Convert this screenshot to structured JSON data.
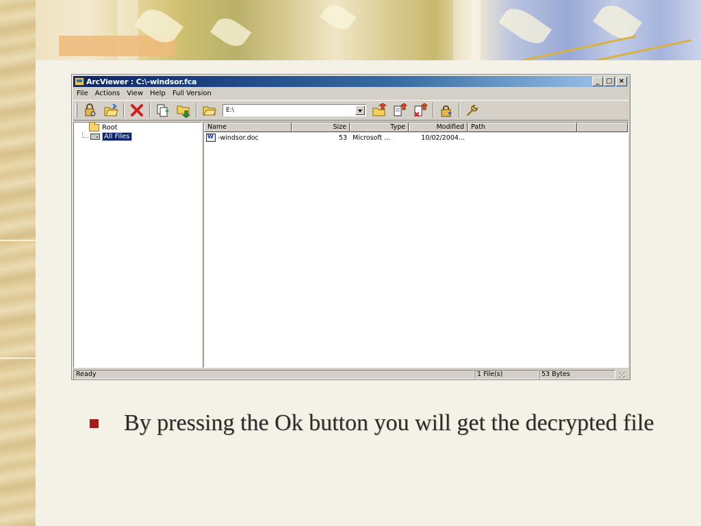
{
  "window": {
    "title": "ArcViewer : C:\\-windsor.fca",
    "minimize_label": "_",
    "maximize_label": "□",
    "close_label": "×"
  },
  "menu": [
    "File",
    "Actions",
    "View",
    "Help",
    "Full Version"
  ],
  "toolbar": {
    "path_value": "E:\\",
    "icons": [
      "decrypt-key-icon",
      "open-folder-icon",
      "delete-icon",
      "extract-icon",
      "extract-folder-icon",
      "folder-icon",
      "add-file-icon",
      "add-document-icon",
      "remove-file-icon",
      "lock-icon",
      "settings-wrench-icon"
    ]
  },
  "tree": {
    "root_label": "Root",
    "all_files_label": "All Files"
  },
  "list": {
    "columns": [
      "Name",
      "Size",
      "Type",
      "Modified",
      "Path"
    ],
    "rows": [
      {
        "name": "-windsor.doc",
        "size": "53",
        "type": "Microsoft ...",
        "modified": "10/02/2004...",
        "path": ""
      }
    ]
  },
  "status": {
    "text": "Ready",
    "file_count": "1 File(s)",
    "size": "53 Bytes"
  },
  "slide": {
    "caption": "By pressing the Ok button you will get the decrypted file",
    "bullet_color": "#a61c1c"
  }
}
